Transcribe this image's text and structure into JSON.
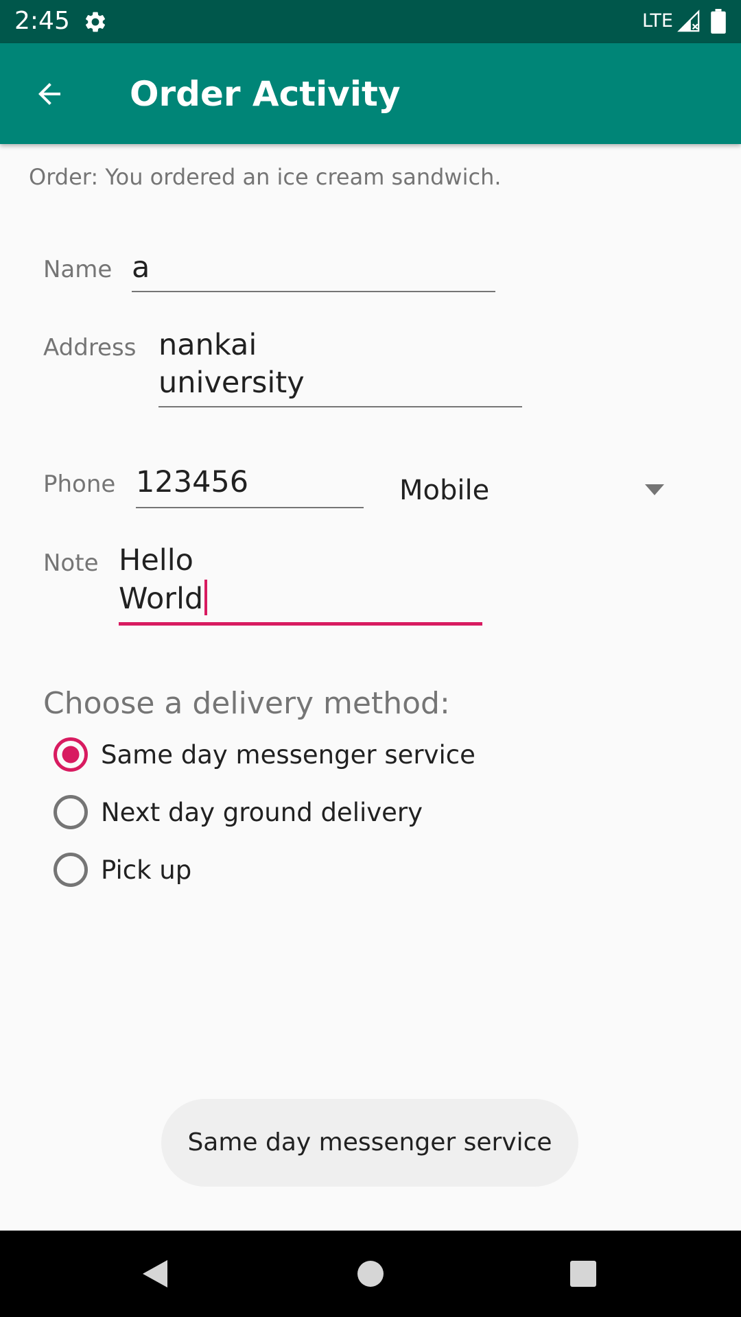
{
  "status_bar": {
    "time": "2:45",
    "network": "LTE",
    "icons": [
      "settings-gear-icon",
      "signal-icon",
      "battery-icon"
    ]
  },
  "app_bar": {
    "title": "Order Activity",
    "back_icon": "arrow-back-icon"
  },
  "order": {
    "message": "Order: You ordered an ice cream sandwich."
  },
  "form": {
    "name_label": "Name",
    "name_value": "a",
    "address_label": "Address",
    "address_value": "nankai\nuniversity",
    "phone_label": "Phone",
    "phone_value": "123456",
    "phone_type": "Mobile",
    "note_label": "Note",
    "note_value": "Hello\nWorld"
  },
  "delivery": {
    "heading": "Choose a delivery method:",
    "options": [
      {
        "label": "Same day messenger service",
        "selected": true
      },
      {
        "label": "Next day ground delivery",
        "selected": false
      },
      {
        "label": "Pick up",
        "selected": false
      }
    ]
  },
  "toast": {
    "message": "Same day messenger service"
  },
  "colors": {
    "primary": "#008577",
    "primary_dark": "#00574b",
    "accent": "#d81b60",
    "background": "#fafafa",
    "text_secondary": "#757575",
    "text_primary": "#212121",
    "toast_background": "#efefef"
  },
  "nav_bar": {
    "icons": [
      "back-triangle-icon",
      "home-circle-icon",
      "recents-square-icon"
    ]
  }
}
